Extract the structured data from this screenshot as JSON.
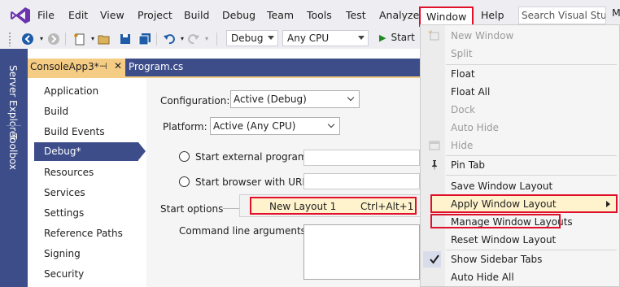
{
  "menubar": {
    "items": [
      "File",
      "Edit",
      "View",
      "Project",
      "Build",
      "Debug",
      "Team",
      "Tools",
      "Test",
      "Analyze",
      "Window",
      "Help"
    ],
    "search_placeholder": "Search Visual Studio",
    "user": "Mitch B"
  },
  "toolbar": {
    "configuration": "Debug",
    "platform": "Any CPU",
    "start_label": "Start"
  },
  "side_tabs": [
    "Server Explorer",
    "Toolbox"
  ],
  "doc_tabs": {
    "active": "ConsoleApp3*",
    "other": "Program.cs"
  },
  "nav": {
    "items": [
      "Application",
      "Build",
      "Build Events",
      "Debug*",
      "Resources",
      "Services",
      "Settings",
      "Reference Paths",
      "Signing",
      "Security"
    ],
    "active_index": 3
  },
  "page": {
    "configuration_label": "Configuration:",
    "configuration_value": "Active (Debug)",
    "platform_label": "Platform:",
    "platform_value": "Active (Any CPU)",
    "start_external": "Start external program:",
    "start_browser": "Start browser with URL:",
    "start_options": "Start options",
    "command_line_args": "Command line arguments:"
  },
  "layout_submenu": {
    "label": "New Layout 1",
    "shortcut": "Ctrl+Alt+1"
  },
  "window_menu": {
    "new_window": "New Window",
    "split": "Split",
    "float": "Float",
    "float_all": "Float All",
    "dock": "Dock",
    "auto_hide": "Auto Hide",
    "hide": "Hide",
    "pin_tab": "Pin Tab",
    "save_layout": "Save Window Layout",
    "apply_layout": "Apply Window Layout",
    "manage_layouts": "Manage Window Layouts",
    "reset_layout": "Reset Window Layout",
    "show_sidebar_tabs": "Show Sidebar Tabs",
    "auto_hide_all": "Auto Hide All"
  },
  "colors": {
    "accent": "#3c4d8a",
    "tab_gold": "#f5cc84",
    "highlight_red": "#e0102a",
    "hover_fill": "#fff3cd"
  }
}
